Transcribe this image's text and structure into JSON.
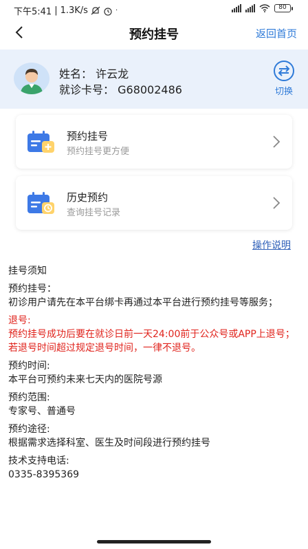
{
  "status_bar": {
    "time": "下午5:41",
    "network_speed": "1.3K/s",
    "battery": "80"
  },
  "nav": {
    "title": "预约挂号",
    "home_link": "返回首页"
  },
  "user": {
    "name_label": "姓名：",
    "name": "许云龙",
    "card_label": "就诊卡号：",
    "card_number": "G68002486",
    "switch_label": "切换"
  },
  "menu": [
    {
      "title": "预约挂号",
      "subtitle": "预约挂号更方便"
    },
    {
      "title": "历史预约",
      "subtitle": "查询挂号记录"
    }
  ],
  "help_link": "操作说明",
  "notice": {
    "heading": "挂号须知",
    "booking_title": "预约挂号：",
    "booking_text": "初诊用户请先在本平台绑卡再通过本平台进行预约挂号等服务；",
    "cancel_title": "退号:",
    "cancel_text": "预约挂号成功后要在就诊日前一天24:00前于公众号或APP上退号；若退号时间超过规定退号时间，一律不退号。",
    "time_title": "预约时间:",
    "time_text": "本平台可预约未来七天内的医院号源",
    "scope_title": "预约范围:",
    "scope_text": "专家号、普通号",
    "channel_title": "预约途径:",
    "channel_text": "根据需求选择科室、医生及时间段进行预约挂号",
    "support_title": "技术支持电话:",
    "support_phone": "0335-8395369"
  },
  "colors": {
    "accent": "#2e7ad8",
    "warning": "#e0231c",
    "user_bar_bg": "#eaf1fb"
  }
}
